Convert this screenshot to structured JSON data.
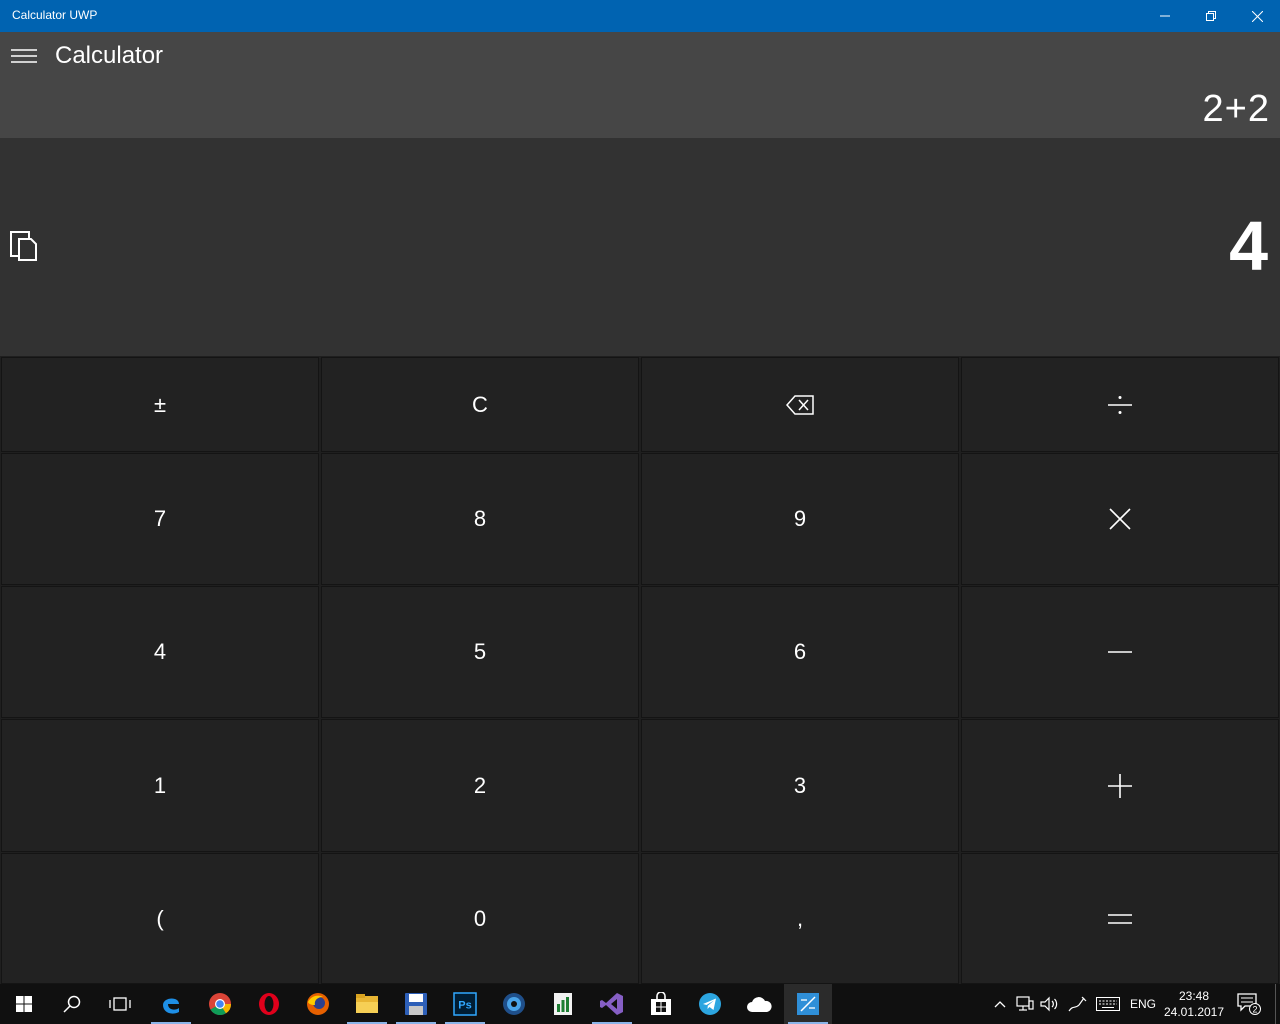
{
  "window": {
    "title": "Calculator UWP"
  },
  "header": {
    "title": "Calculator",
    "expression": "2+2"
  },
  "display": {
    "result": "4"
  },
  "keypad": {
    "rows": [
      [
        "±",
        "C",
        "backspace",
        "÷"
      ],
      [
        "7",
        "8",
        "9",
        "×"
      ],
      [
        "4",
        "5",
        "6",
        "−"
      ],
      [
        "1",
        "2",
        "3",
        "+"
      ],
      [
        "(",
        "0",
        ",",
        "="
      ]
    ],
    "k_plusminus": "±",
    "k_clear": "C",
    "k_7": "7",
    "k_8": "8",
    "k_9": "9",
    "k_4": "4",
    "k_5": "5",
    "k_6": "6",
    "k_1": "1",
    "k_2": "2",
    "k_3": "3",
    "k_paren": "(",
    "k_0": "0",
    "k_comma": ","
  },
  "taskbar": {
    "apps": [
      "start-icon",
      "search-icon",
      "task-view-icon",
      "edge-icon",
      "chrome-icon",
      "opera-icon",
      "firefox-icon",
      "file-explorer-icon",
      "save-app-icon",
      "photoshop-icon",
      "media-app-icon",
      "spreadsheet-app-icon",
      "visual-studio-icon",
      "store-icon",
      "telegram-icon",
      "onedrive-icon",
      "calculator-app-icon"
    ],
    "photoshop_label": "Ps",
    "language": "ENG",
    "time": "23:48",
    "date": "24.01.2017",
    "notification_count": "2"
  },
  "colors": {
    "titlebar": "#0063b1",
    "header": "#464646",
    "display": "#323232",
    "key": "#222222",
    "taskbar": "#101010"
  }
}
